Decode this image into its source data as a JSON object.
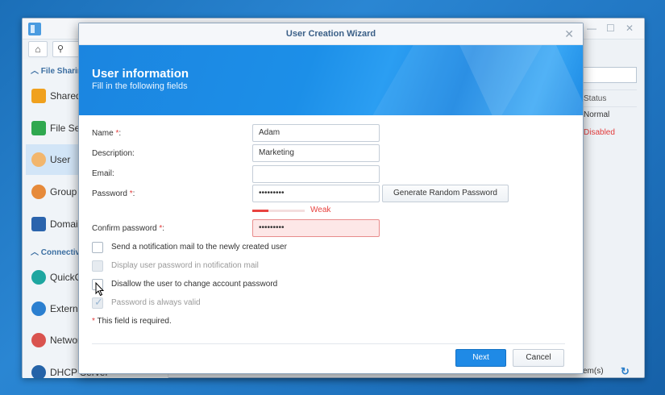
{
  "background_window": {
    "sidebar": {
      "section_file_sharing": "File Sharing",
      "section_connectivity": "Connectivity",
      "items": [
        {
          "label": "Shared Folder",
          "icon": "shared-folder-icon"
        },
        {
          "label": "File Services",
          "icon": "file-services-icon"
        },
        {
          "label": "User",
          "icon": "user-icon"
        },
        {
          "label": "Group",
          "icon": "group-icon"
        },
        {
          "label": "Domain/LDAP",
          "icon": "domain-icon"
        },
        {
          "label": "QuickConnect",
          "icon": "quickconnect-icon"
        },
        {
          "label": "External Access",
          "icon": "external-access-icon"
        },
        {
          "label": "Network",
          "icon": "network-icon"
        },
        {
          "label": "DHCP Server",
          "icon": "dhcp-server-icon"
        }
      ]
    },
    "table": {
      "header": "Status",
      "rows": [
        "Normal",
        "Disabled"
      ],
      "footer": "item(s)"
    }
  },
  "dialog": {
    "title": "User Creation Wizard",
    "banner_title": "User information",
    "banner_subtitle": "Fill in the following fields",
    "labels": {
      "name": "Name",
      "description": "Description:",
      "email": "Email:",
      "password": "Password",
      "confirm": "Confirm password",
      "required_mark": "*",
      "colon": ":"
    },
    "values": {
      "name": "Adam",
      "description": "Marketing",
      "email": "",
      "password": "•••••••••",
      "confirm": "•••••••••"
    },
    "generate_button": "Generate Random Password",
    "password_strength": {
      "label": "Weak",
      "level": 0.3
    },
    "checkboxes": [
      {
        "label": "Send a notification mail to the newly created user",
        "checked": false,
        "disabled": false
      },
      {
        "label": "Display user password in notification mail",
        "checked": false,
        "disabled": true
      },
      {
        "label": "Disallow the user to change account password",
        "checked": false,
        "disabled": false
      },
      {
        "label": "Password is always valid",
        "checked": true,
        "disabled": true
      }
    ],
    "required_note": "This field is required.",
    "next_button": "Next",
    "cancel_button": "Cancel"
  },
  "colors": {
    "accent": "#1f8ae6",
    "error": "#e8433f",
    "banner": "#1b85e0"
  }
}
